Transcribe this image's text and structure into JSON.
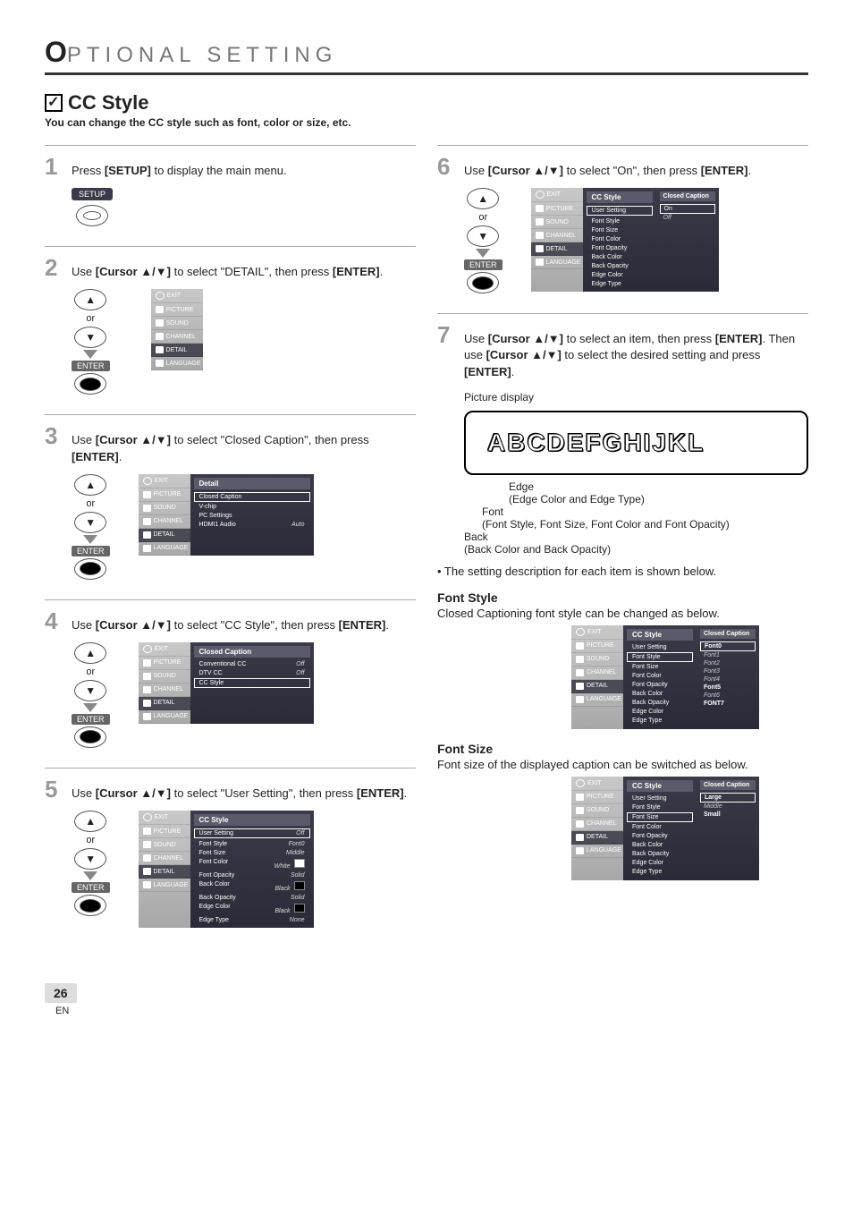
{
  "header": "PTIONAL   SETTING",
  "title": "CC Style",
  "subtitle": "You can change the CC style such as font, color or size, etc.",
  "steps": {
    "s1": {
      "num": "1",
      "text_pre": "Press ",
      "text_bold": "[SETUP]",
      "text_post": " to display the main menu."
    },
    "s2": {
      "num": "2",
      "text_pre": "Use ",
      "text_bold": "[Cursor ▲/▼]",
      "text_mid": " to select \"DETAIL\", then press ",
      "text_bold2": "[ENTER]",
      "text_post": "."
    },
    "s3": {
      "num": "3",
      "text_pre": "Use ",
      "text_bold": "[Cursor ▲/▼]",
      "text_mid": " to select \"Closed Caption\", then press ",
      "text_bold2": "[ENTER]",
      "text_post": "."
    },
    "s4": {
      "num": "4",
      "text_pre": "Use ",
      "text_bold": "[Cursor ▲/▼]",
      "text_mid": " to select \"CC Style\", then press ",
      "text_bold2": "[ENTER]",
      "text_post": "."
    },
    "s5": {
      "num": "5",
      "text_pre": "Use ",
      "text_bold": "[Cursor ▲/▼]",
      "text_mid": " to select \"User Setting\", then press ",
      "text_bold2": "[ENTER]",
      "text_post": "."
    },
    "s6": {
      "num": "6",
      "text_pre": "Use ",
      "text_bold": "[Cursor ▲/▼]",
      "text_mid": " to select \"On\", then press ",
      "text_bold2": "[ENTER]",
      "text_post": "."
    },
    "s7": {
      "num": "7",
      "text_pre": "Use ",
      "text_bold": "[Cursor ▲/▼]",
      "text_mid": " to select an item, then press ",
      "text_bold2": "[ENTER]",
      "text_mid2": ". Then use ",
      "text_bold3": "[Cursor ▲/▼]",
      "text_mid3": " to select the desired setting and press ",
      "text_bold4": "[ENTER]",
      "text_post": "."
    }
  },
  "remote": {
    "setup": "SETUP",
    "or": "or",
    "enter": "ENTER",
    "up": "▲",
    "down": "▼"
  },
  "sidebar": {
    "exit": "EXIT",
    "picture": "PICTURE",
    "sound": "SOUND",
    "channel": "CHANNEL",
    "detail": "DETAIL",
    "language": "LANGUAGE"
  },
  "osd3": {
    "header": "Detail",
    "items": [
      "Closed Caption",
      "V-chip",
      "PC Settings",
      "HDMI1 Audio"
    ],
    "val_hdmi": "Auto"
  },
  "osd4": {
    "header": "Closed Caption",
    "items": [
      "Conventional CC",
      "DTV CC",
      "CC Style"
    ],
    "val_off": "Off"
  },
  "osd5": {
    "header": "CC Style",
    "items": [
      "User Setting",
      "Font Style",
      "Font Size",
      "Font Color",
      "Font Opacity",
      "Back Color",
      "Back Opacity",
      "Edge Color",
      "Edge Type"
    ],
    "vals": [
      "Off",
      "Font0",
      "Middle",
      "White",
      "Solid",
      "Black",
      "Solid",
      "Black",
      "None"
    ]
  },
  "osd6": {
    "header_main": "CC Style",
    "header_right": "Closed Caption",
    "items": [
      "User Setting",
      "Font Style",
      "Font Size",
      "Font Color",
      "Font Opacity",
      "Back Color",
      "Back Opacity",
      "Edge Color",
      "Edge Type"
    ],
    "right": [
      "On",
      "Off"
    ]
  },
  "picdisplay": {
    "label": "Picture display",
    "letters": "ABCDEFGHIJKL",
    "edge_label": "Edge",
    "edge_desc": "(Edge Color and Edge Type)",
    "font_label": "Font",
    "font_desc": "(Font Style, Font Size, Font Color and Font Opacity)",
    "back_label": "Back",
    "back_desc": "(Back Color and Back Opacity)",
    "bullet": "• The setting description for each item is shown below."
  },
  "fontstyle": {
    "head": "Font Style",
    "desc": "Closed Captioning font style can be changed as below.",
    "header_main": "CC Style",
    "header_right": "Closed Caption",
    "items": [
      "User Setting",
      "Font Style",
      "Font Size",
      "Font Color",
      "Font Opacity",
      "Back Color",
      "Back Opacity",
      "Edge Color",
      "Edge Type"
    ],
    "right": [
      "Font0",
      "Font1",
      "Font2",
      "Font3",
      "Font4",
      "Font5",
      "Font6",
      "FONT7"
    ]
  },
  "fontsize": {
    "head": "Font Size",
    "desc": "Font size of the displayed caption can be switched as below.",
    "header_main": "CC Style",
    "header_right": "Closed Caption",
    "items": [
      "User Setting",
      "Font Style",
      "Font Size",
      "Font Color",
      "Font Opacity",
      "Back Color",
      "Back Opacity",
      "Edge Color",
      "Edge Type"
    ],
    "right": [
      "Large",
      "Middle",
      "Small"
    ]
  },
  "footer": {
    "page": "26",
    "lang": "EN"
  }
}
